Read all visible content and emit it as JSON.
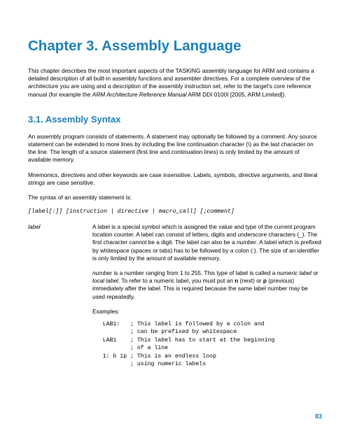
{
  "chapter_title": "Chapter 3. Assembly Language",
  "intro": "This chapter describes the most important aspects of the TASKING assembly language for ARM and contains a detailed description of all built-in assembly functions and assembler directives. For a complete overview of the architecture you are using and a description of the assembly instruction set, refer to the target's core reference manual (for example the ",
  "intro_em": "ARM Architecture Reference Manual",
  "intro_tail": " ARM DDI 0100I [2005, ARM Limited]).",
  "section_title": "3.1. Assembly Syntax",
  "para1": "An assembly program consists of statements. A statement may optionally be followed by a comment. Any source statement can be extended to more lines by including the line continuation character (\\) as the last character on the line. The length of a source statement (first line and continuation lines) is only limited by the amount of available memory.",
  "para2": "Mnemonics, directives and other keywords are case insensitive. Labels, symbols, directive arguments, and literal strings are case sensitive.",
  "para3": "The syntax of an assembly statement is:",
  "syntax": "[label[:]] [instruction | directive | macro_call] [;comment]",
  "def_term": "label",
  "def1_a": "A label is a special symbol which is assigned the value and type of the current program location counter. A label can consist of letters, digits and underscore characters (_). The first character cannot be a digit. The label can also be a ",
  "def1_em1": "number",
  "def1_b": ". A label which is prefixed by whitespace (spaces or tabs) has to be followed by a colon (:). The size of an identifier is only limited by the amount of available memory.",
  "def2_em1": "number",
  "def2_a": " is a number ranging from 1 to 255. This type of label is called a ",
  "def2_em2": "numeric label",
  "def2_b": " or ",
  "def2_em3": "local label",
  "def2_c": ". To refer to a numeric label, you must put an ",
  "def2_s1": "n",
  "def2_d": " (next) or ",
  "def2_s2": "p",
  "def2_e": " (previous) immediately after the label. This is required because the same label number may be used repeatedly.",
  "examples": "Examples:",
  "code": "   LAB1:   ; This label is followed by a colon and\n           ; can be prefixed by whitespace\n   LAB1    ; This label has to start at the beginning\n           ; of a line\n   1: b 1p ; This is an endless loop\n           ; using numeric labels",
  "page_num": "83"
}
